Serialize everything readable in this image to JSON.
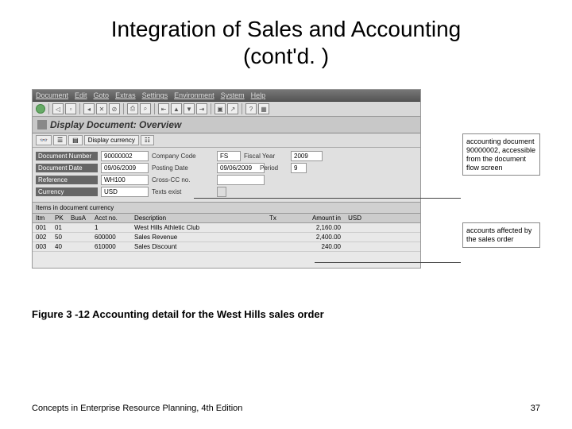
{
  "slide": {
    "title_line1": "Integration of Sales and Accounting",
    "title_line2": "(cont'd. )"
  },
  "menubar": [
    "Document",
    "Edit",
    "Goto",
    "Extras",
    "Settings",
    "Environment",
    "System",
    "Help"
  ],
  "screen_title": "Display Document: Overview",
  "subtoolbar": {
    "display_currency": "Display currency"
  },
  "form": {
    "doc_num_label": "Document Number",
    "doc_num": "90000002",
    "company_code_label": "Company Code",
    "company_code": "FS",
    "fiscal_year_label": "Fiscal Year",
    "fiscal_year": "2009",
    "doc_date_label": "Document Date",
    "doc_date": "09/06/2009",
    "posting_date_label": "Posting Date",
    "posting_date": "09/06/2009",
    "period_label": "Period",
    "period": "9",
    "reference_label": "Reference",
    "reference": "WH100",
    "cross_cc_label": "Cross-CC no.",
    "cross_cc": "",
    "currency_label": "Currency",
    "currency": "USD",
    "texts_label": "Texts exist",
    "texts": ""
  },
  "items_header": "Items in document currency",
  "table": {
    "headers": {
      "itm": "Itm",
      "pk": "PK",
      "bus": "BusA",
      "acct": "Acct no.",
      "desc": "Description",
      "tx": "Tx",
      "amt": "Amount in",
      "cur": "USD"
    },
    "rows": [
      {
        "itm": "001",
        "pk": "01",
        "bus": "",
        "acct": "1",
        "desc": "West Hills Athletic Club",
        "tx": "",
        "amt": "2,160.00",
        "cur": ""
      },
      {
        "itm": "002",
        "pk": "50",
        "bus": "",
        "acct": "600000",
        "desc": "Sales Revenue",
        "tx": "",
        "amt": "2,400.00",
        "cur": ""
      },
      {
        "itm": "003",
        "pk": "40",
        "bus": "",
        "acct": "610000",
        "desc": "Sales Discount",
        "tx": "",
        "amt": "240.00",
        "cur": ""
      }
    ]
  },
  "annotations": {
    "a1": "accounting document 90000002, accessible from the document flow screen",
    "a2": "accounts affected by the sales order"
  },
  "caption": "Figure 3 -12  Accounting detail for the West Hills sales order",
  "footer": {
    "left": "Concepts in Enterprise Resource Planning, 4th Edition",
    "right": "37"
  }
}
